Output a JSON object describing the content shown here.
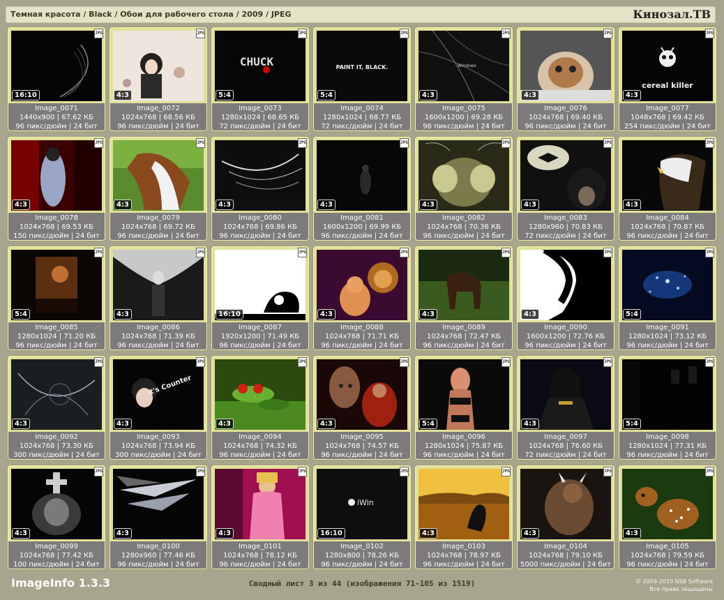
{
  "header": {
    "breadcrumb": "Темная красота / Black / Обои для рабочего стола / 2009 / JPEG",
    "brand": "Кинозал.ТВ"
  },
  "file_badge": "JPG",
  "images": [
    {
      "name": "Image_0071",
      "res": "1440x900",
      "size": "67.62 КБ",
      "dpi": "96 пикс/дюйм",
      "bits": "24 бит",
      "ratio": "16:10",
      "theme": "dark-swirl"
    },
    {
      "name": "Image_0072",
      "res": "1024x768",
      "size": "68.56 КБ",
      "dpi": "96 пикс/дюйм",
      "bits": "24 бит",
      "ratio": "4:3",
      "theme": "light-girl"
    },
    {
      "name": "Image_0073",
      "res": "1280x1024",
      "size": "68.65 КБ",
      "dpi": "72 пикс/дюйм",
      "bits": "24 бит",
      "ratio": "5:4",
      "theme": "chuck"
    },
    {
      "name": "Image_0074",
      "res": "1280x1024",
      "size": "68.77 КБ",
      "dpi": "72 пикс/дюйм",
      "bits": "24 бит",
      "ratio": "5:4",
      "theme": "paint-it-black"
    },
    {
      "name": "Image_0075",
      "res": "1600x1200",
      "size": "69.28 КБ",
      "dpi": "96 пикс/дюйм",
      "bits": "24 бит",
      "ratio": "4:3",
      "theme": "windows"
    },
    {
      "name": "Image_0076",
      "res": "1024x768",
      "size": "69.40 КБ",
      "dpi": "96 пикс/дюйм",
      "bits": "24 бит",
      "ratio": "4:3",
      "theme": "kitten"
    },
    {
      "name": "Image_0077",
      "res": "1048x768",
      "size": "69.42 КБ",
      "dpi": "254 пикс/дюйм",
      "bits": "24 бит",
      "ratio": "4:3",
      "theme": "cereal-killer"
    },
    {
      "name": "Image_0078",
      "res": "1024x768",
      "size": "69.53 КБ",
      "dpi": "150 пикс/дюйм",
      "bits": "24 бит",
      "ratio": "4:3",
      "theme": "red-figure"
    },
    {
      "name": "Image_0079",
      "res": "1024x768",
      "size": "69.72 КБ",
      "dpi": "96 пикс/дюйм",
      "bits": "24 бит",
      "ratio": "4:3",
      "theme": "horse"
    },
    {
      "name": "Image_0080",
      "res": "1024x768",
      "size": "69.86 КБ",
      "dpi": "96 пикс/дюйм",
      "bits": "24 бит",
      "ratio": "4:3",
      "theme": "abstract-white"
    },
    {
      "name": "Image_0081",
      "res": "1600x1200",
      "size": "69.99 КБ",
      "dpi": "96 пикс/дюйм",
      "bits": "24 бит",
      "ratio": "4:3",
      "theme": "dark-figure"
    },
    {
      "name": "Image_0082",
      "res": "1024x768",
      "size": "70.36 КБ",
      "dpi": "96 пикс/дюйм",
      "bits": "24 бит",
      "ratio": "4:3",
      "theme": "insect"
    },
    {
      "name": "Image_0083",
      "res": "1280x960",
      "size": "70.83 КБ",
      "dpi": "72 пикс/дюйм",
      "bits": "24 бит",
      "ratio": "4:3",
      "theme": "batman"
    },
    {
      "name": "Image_0084",
      "res": "1024x768",
      "size": "70.87 КБ",
      "dpi": "96 пикс/дюйм",
      "bits": "24 бит",
      "ratio": "4:3",
      "theme": "eagle"
    },
    {
      "name": "Image_0085",
      "res": "1280x1024",
      "size": "71.20 КБ",
      "dpi": "96 пикс/дюйм",
      "bits": "24 бит",
      "ratio": "5:4",
      "theme": "dark-orange"
    },
    {
      "name": "Image_0086",
      "res": "1024x768",
      "size": "71.39 КБ",
      "dpi": "96 пикс/дюйм",
      "bits": "24 бит",
      "ratio": "4:3",
      "theme": "angel"
    },
    {
      "name": "Image_0087",
      "res": "1920x1200",
      "size": "71.49 КБ",
      "dpi": "96 пикс/дюйм",
      "bits": "24 бит",
      "ratio": "16:10",
      "theme": "white-shape"
    },
    {
      "name": "Image_0088",
      "res": "1024x768",
      "size": "71.71 КБ",
      "dpi": "96 пикс/дюйм",
      "bits": "24 бит",
      "ratio": "4:3",
      "theme": "cat-lion"
    },
    {
      "name": "Image_0089",
      "res": "1024x768",
      "size": "72.47 КБ",
      "dpi": "96 пикс/дюйм",
      "bits": "24 бит",
      "ratio": "4:3",
      "theme": "horse-field"
    },
    {
      "name": "Image_0090",
      "res": "1600x1200",
      "size": "72.76 КБ",
      "dpi": "96 пикс/дюйм",
      "bits": "24 бит",
      "ratio": "4:3",
      "theme": "face-silhouette"
    },
    {
      "name": "Image_0091",
      "res": "1280x1024",
      "size": "73.12 КБ",
      "dpi": "96 пикс/дюйм",
      "bits": "24 бит",
      "ratio": "5:4",
      "theme": "blue-sparkle"
    },
    {
      "name": "Image_0092",
      "res": "1024x768",
      "size": "73.30 КБ",
      "dpi": "300 пикс/дюйм",
      "bits": "24 бит",
      "ratio": "4:3",
      "theme": "grey-swirl"
    },
    {
      "name": "Image_0093",
      "res": "1024x768",
      "size": "73.94 КБ",
      "dpi": "300 пикс/дюйм",
      "bits": "24 бит",
      "ratio": "4:3",
      "theme": "counter"
    },
    {
      "name": "Image_0094",
      "res": "1024x768",
      "size": "74.32 КБ",
      "dpi": "96 пикс/дюйм",
      "bits": "24 бит",
      "ratio": "4:3",
      "theme": "frog"
    },
    {
      "name": "Image_0095",
      "res": "1024x768",
      "size": "74.57 КБ",
      "dpi": "96 пикс/дюйм",
      "bits": "24 бит",
      "ratio": "4:3",
      "theme": "warrior"
    },
    {
      "name": "Image_0096",
      "res": "1280x1024",
      "size": "75.87 КБ",
      "dpi": "96 пикс/дюйм",
      "bits": "24 бит",
      "ratio": "5:4",
      "theme": "woman-dark"
    },
    {
      "name": "Image_0097",
      "res": "1024x768",
      "size": "76.60 КБ",
      "dpi": "72 пикс/дюйм",
      "bits": "24 бит",
      "ratio": "4:3",
      "theme": "gothic-woman"
    },
    {
      "name": "Image_0098",
      "res": "1280x1024",
      "size": "77.31 КБ",
      "dpi": "96 пикс/дюйм",
      "bits": "24 бит",
      "ratio": "5:4",
      "theme": "dark-room"
    },
    {
      "name": "Image_0099",
      "res": "1024x768",
      "size": "77.42 КБ",
      "dpi": "100 пикс/дюйм",
      "bits": "24 бит",
      "ratio": "4:3",
      "theme": "gothic-cross"
    },
    {
      "name": "Image_0100",
      "res": "1280x960",
      "size": "77.46 КБ",
      "dpi": "96 пикс/дюйм",
      "bits": "24 бит",
      "ratio": "4:3",
      "theme": "shards"
    },
    {
      "name": "Image_0101",
      "res": "1024x768",
      "size": "78.12 КБ",
      "dpi": "96 пикс/дюйм",
      "bits": "24 бит",
      "ratio": "4:3",
      "theme": "pink-woman"
    },
    {
      "name": "Image_0102",
      "res": "1280x800",
      "size": "78.26 КБ",
      "dpi": "96 пикс/дюйм",
      "bits": "24 бит",
      "ratio": "16:10",
      "theme": "iwin"
    },
    {
      "name": "Image_0103",
      "res": "1024x768",
      "size": "78.97 КБ",
      "dpi": "96 пикс/дюйм",
      "bits": "24 бит",
      "ratio": "4:3",
      "theme": "sunset-whale"
    },
    {
      "name": "Image_0104",
      "res": "1024x768",
      "size": "79.10 КБ",
      "dpi": "5000 пикс/дюйм",
      "bits": "24 бит",
      "ratio": "4:3",
      "theme": "beast"
    },
    {
      "name": "Image_0105",
      "res": "1024x768",
      "size": "79.59 КБ",
      "dpi": "96 пикс/дюйм",
      "bits": "24 бит",
      "ratio": "4:3",
      "theme": "fawn"
    }
  ],
  "thumb_texts": {
    "chuck": "CHUCK",
    "paint_it_black": "PAINT IT, BLACK.",
    "windows": "Windows",
    "cereal_killer": "cereal killer",
    "counter": "it's Counter",
    "iwin": "iWin"
  },
  "footer": {
    "app": "ImageInfo 1.3.3",
    "summary": "Сводный лист 3 из 44 (изображения 71-105 из 1519)",
    "copyright": "© 2009-2010 NSB Software",
    "rights": "Все права защищены"
  }
}
